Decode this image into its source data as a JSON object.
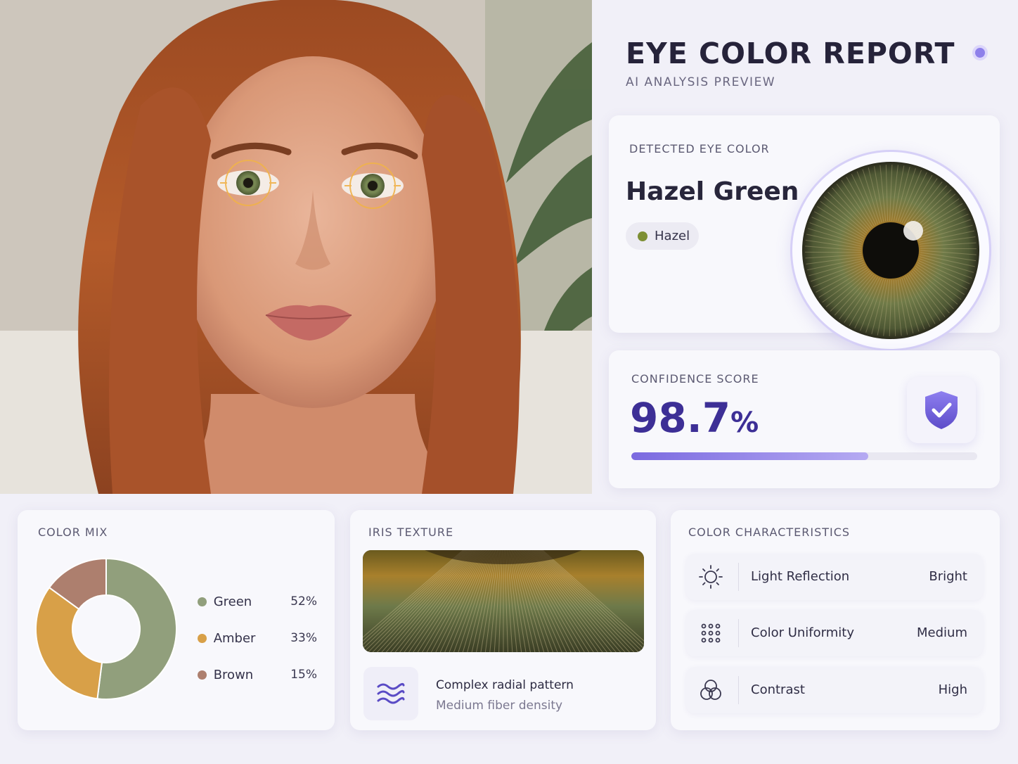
{
  "header": {
    "title": "EYE COLOR REPORT",
    "subtitle": "AI ANALYSIS PREVIEW"
  },
  "detected": {
    "label": "DETECTED EYE COLOR",
    "value": "Hazel Green",
    "tag": "Hazel",
    "tag_color": "#7d8f34"
  },
  "confidence": {
    "label": "CONFIDENCE SCORE",
    "value": "98.7",
    "unit": "%",
    "progress_fraction": 0.685,
    "icon": "shield-check-icon"
  },
  "color_mix": {
    "label": "COLOR MIX",
    "chart_data": {
      "type": "pie",
      "categories": [
        "Green",
        "Amber",
        "Brown"
      ],
      "values": [
        52,
        33,
        15
      ],
      "value_labels": [
        "52%",
        "33%",
        "15%"
      ],
      "colors": [
        "#919f7c",
        "#d8a048",
        "#ad7f6e"
      ],
      "title": "",
      "legend": "right"
    }
  },
  "iris_texture": {
    "label": "IRIS TEXTURE",
    "pattern": "Complex radial pattern",
    "density": "Medium fiber density",
    "icon": "waves-icon"
  },
  "characteristics": {
    "label": "COLOR CHARACTERISTICS",
    "items": [
      {
        "name": "Light Reflection",
        "value": "Bright",
        "icon": "sun-icon"
      },
      {
        "name": "Color Uniformity",
        "value": "Medium",
        "icon": "dots-grid-icon"
      },
      {
        "name": "Contrast",
        "value": "High",
        "icon": "overlap-circles-icon"
      }
    ]
  },
  "colors": {
    "accent": "#3d2f96",
    "accent_light": "#8e80ea"
  }
}
